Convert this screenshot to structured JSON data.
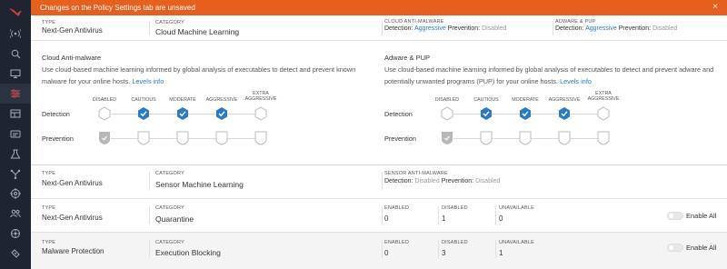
{
  "banner": {
    "message": "Changes on the Policy Settings tab are unsaved",
    "close": "×"
  },
  "sidebar": {
    "items": [
      {
        "icon": "falcon-logo-icon"
      },
      {
        "icon": "activity-icon"
      },
      {
        "icon": "investigate-icon"
      },
      {
        "icon": "hosts-icon"
      },
      {
        "icon": "configuration-icon",
        "active": true
      },
      {
        "icon": "dashboards-icon"
      },
      {
        "icon": "spotlight-icon"
      },
      {
        "icon": "discover-icon"
      },
      {
        "icon": "threat-graph-icon"
      },
      {
        "icon": "intelligence-icon"
      },
      {
        "icon": "users-icon"
      },
      {
        "icon": "settings-icon"
      },
      {
        "icon": "support-icon"
      }
    ]
  },
  "cloud_ml": {
    "type_label": "TYPE",
    "type": "Next-Gen Antivirus",
    "category_label": "CATEGORY",
    "category": "Cloud Machine Learning",
    "summary1": {
      "label": "CLOUD ANTI-MALWARE",
      "det_label": "Detection:",
      "det_value": "Aggressive",
      "prev_label": "Prevention:",
      "prev_value": "Disabled"
    },
    "summary2": {
      "label": "ADWARE & PUP",
      "det_label": "Detection:",
      "det_value": "Aggressive",
      "prev_label": "Prevention:",
      "prev_value": "Disabled"
    },
    "left": {
      "title": "Cloud Anti-malware",
      "desc_line1": "Use cloud-based machine learning informed by global analysis of executables to detect and prevent known",
      "desc_line2": "malware for your online hosts.",
      "link": "Levels info"
    },
    "right": {
      "title": "Adware & PUP",
      "desc_line1": "Use cloud-based machine learning informed by global analysis of executables to detect and prevent adware and",
      "desc_line2": "potentially unwanted programs (PUP) for your online hosts.",
      "link": "Levels info"
    },
    "levels": {
      "disabled": "DISABLED",
      "cautious": "CAUTIOUS",
      "moderate": "MODERATE",
      "aggressive": "AGGRESSIVE",
      "extra1": "EXTRA",
      "extra2": "AGGRESSIVE"
    },
    "detection_label": "Detection",
    "prevention_label": "Prevention"
  },
  "sensor_ml": {
    "type_label": "TYPE",
    "type": "Next-Gen Antivirus",
    "category_label": "CATEGORY",
    "category": "Sensor Machine Learning",
    "summary": {
      "label": "SENSOR ANTI-MALWARE",
      "det_label": "Detection:",
      "det_value": "Disabled",
      "prev_label": "Prevention:",
      "prev_value": "Disabled"
    }
  },
  "quarantine": {
    "type_label": "TYPE",
    "type": "Next-Gen Antivirus",
    "category_label": "CATEGORY",
    "category": "Quarantine",
    "enabled_label": "ENABLED",
    "enabled": "0",
    "disabled_label": "DISABLED",
    "disabled": "1",
    "unavailable_label": "UNAVAILABLE",
    "unavailable": "0",
    "enable_all": "Enable All"
  },
  "execution_blocking": {
    "type_label": "TYPE",
    "type": "Malware Protection",
    "category_label": "CATEGORY",
    "category": "Execution Blocking",
    "enabled_label": "ENABLED",
    "enabled": "0",
    "disabled_label": "DISABLED",
    "disabled": "3",
    "unavailable_label": "UNAVAILABLE",
    "unavailable": "1",
    "enable_all": "Enable All"
  },
  "colors": {
    "accent": "#2b7bc0",
    "banner": "#e5601f",
    "sidebar": "#1e2430"
  }
}
